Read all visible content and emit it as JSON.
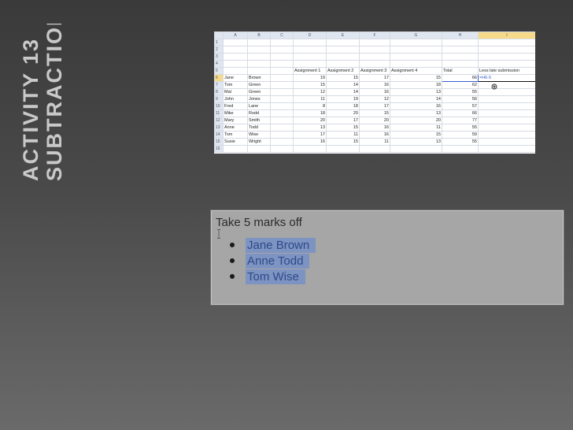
{
  "slide": {
    "title_line1": "ACTIVITY  13",
    "title_line2": "SUBTRACTION"
  },
  "spreadsheet": {
    "columns": [
      "",
      "A",
      "B",
      "C",
      "D",
      "E",
      "F",
      "G",
      "H",
      "I"
    ],
    "header_row": {
      "d": "Assignment 1",
      "e": "Assignment 2",
      "f": "Assignment 3",
      "g": "Assignment 4",
      "h": "Total",
      "i": "Less late submission"
    },
    "rows": [
      {
        "n": "1"
      },
      {
        "n": "2"
      },
      {
        "n": "3"
      },
      {
        "n": "4"
      },
      {
        "n": "6",
        "first": "Jane",
        "last": "Brown",
        "a1": "19",
        "a2": "15",
        "a3": "17",
        "a4": "15",
        "total": "66",
        "less": "=H6-5"
      },
      {
        "n": "7",
        "first": "Tom",
        "last": "Green",
        "a1": "15",
        "a2": "14",
        "a3": "16",
        "a4": "18",
        "total": "62"
      },
      {
        "n": "8",
        "first": "Mal",
        "last": "Green",
        "a1": "12",
        "a2": "14",
        "a3": "16",
        "a4": "13",
        "total": "55"
      },
      {
        "n": "9",
        "first": "John",
        "last": "Jones",
        "a1": "11",
        "a2": "19",
        "a3": "12",
        "a4": "14",
        "total": "56"
      },
      {
        "n": "10",
        "first": "Fred",
        "last": "Lane",
        "a1": "8",
        "a2": "18",
        "a3": "17",
        "a4": "16",
        "total": "57"
      },
      {
        "n": "11",
        "first": "Mike",
        "last": "Rodd",
        "a1": "18",
        "a2": "20",
        "a3": "15",
        "a4": "13",
        "total": "66"
      },
      {
        "n": "12",
        "first": "Mary",
        "last": "Smith",
        "a1": "20",
        "a2": "17",
        "a3": "20",
        "a4": "20",
        "total": "77"
      },
      {
        "n": "13",
        "first": "Anne",
        "last": "Todd",
        "a1": "13",
        "a2": "15",
        "a3": "16",
        "a4": "11",
        "total": "55"
      },
      {
        "n": "14",
        "first": "Tom",
        "last": "Wise",
        "a1": "17",
        "a2": "11",
        "a3": "16",
        "a4": "15",
        "total": "59"
      },
      {
        "n": "15",
        "first": "Susie",
        "last": "Wright",
        "a1": "16",
        "a2": "15",
        "a3": "11",
        "a4": "13",
        "total": "55"
      },
      {
        "n": "16"
      }
    ],
    "header_row_number": "5"
  },
  "textbox": {
    "heading": "Take 5 marks off",
    "items": [
      "Jane Brown",
      "Anne Todd",
      "Tom Wise"
    ]
  }
}
